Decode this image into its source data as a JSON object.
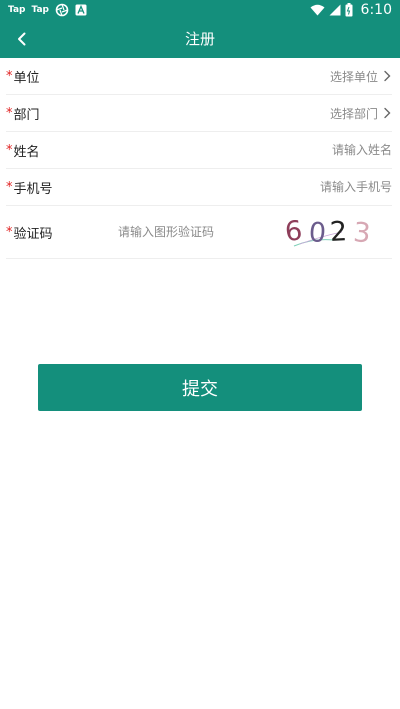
{
  "status_bar": {
    "app_icons": [
      "Tap",
      "Tap"
    ],
    "time": "6:10",
    "icons": [
      "wifi-icon",
      "signal-icon",
      "battery-icon"
    ]
  },
  "app_bar": {
    "title": "注册",
    "back_icon": "chevron-left-icon"
  },
  "form": {
    "required_mark": "*",
    "fields": {
      "unit": {
        "label": "单位",
        "value": "选择单位",
        "type": "select"
      },
      "dept": {
        "label": "部门",
        "value": "选择部门",
        "type": "select"
      },
      "name": {
        "label": "姓名",
        "placeholder": "请输入姓名",
        "type": "text"
      },
      "phone": {
        "label": "手机号",
        "placeholder": "请输入手机号",
        "type": "text"
      },
      "captcha": {
        "label": "验证码",
        "placeholder": "请输入图形验证码",
        "image_text": "6023",
        "type": "captcha"
      }
    }
  },
  "submit_label": "提交",
  "colors": {
    "primary": "#148f7c",
    "required": "#e02020",
    "placeholder": "#8a8a8a",
    "divider": "#eeeeee"
  }
}
